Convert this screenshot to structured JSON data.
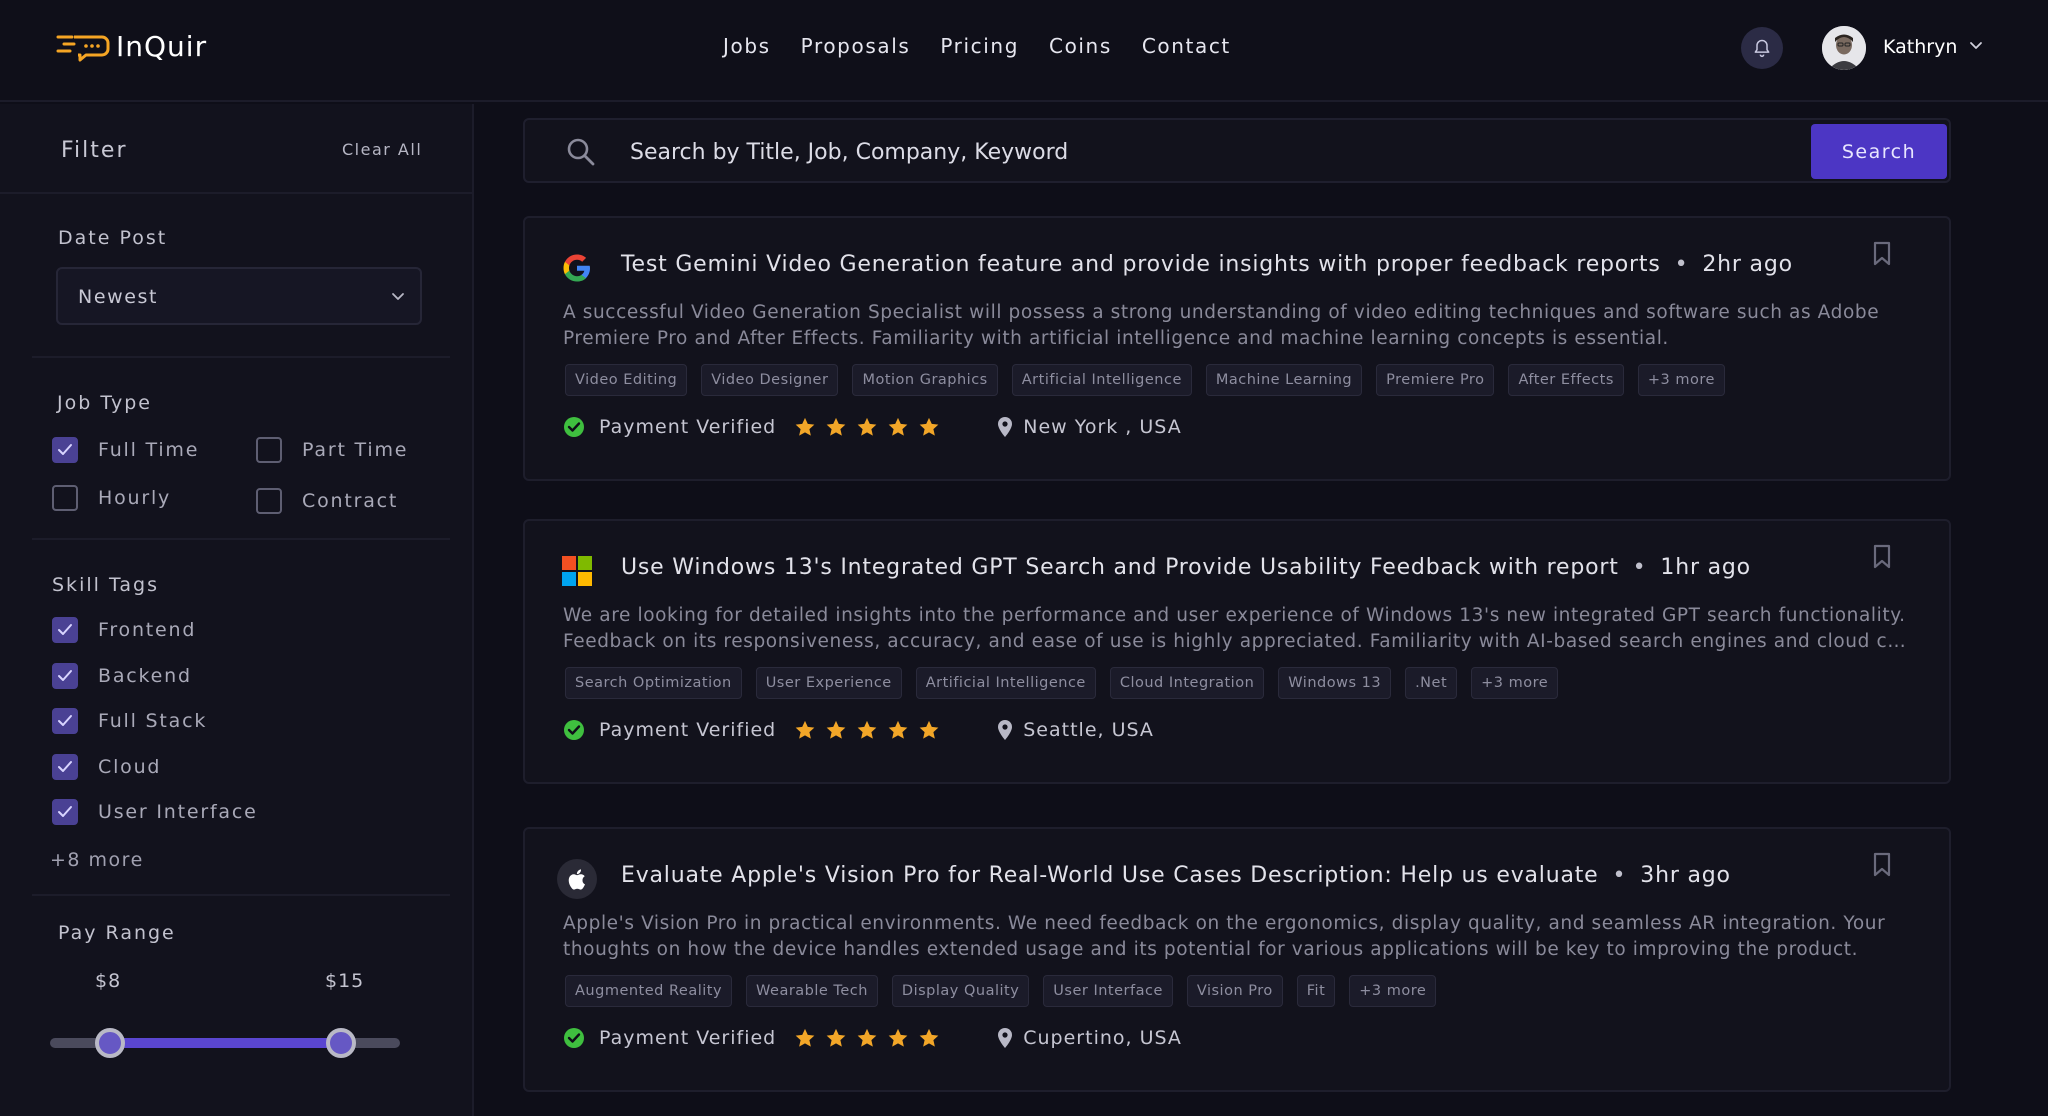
{
  "app": {
    "name": "InQuir",
    "accent": "#4c36c4",
    "logo_color": "#f5a524"
  },
  "nav": [
    "Jobs",
    "Proposals",
    "Pricing",
    "Coins",
    "Contact"
  ],
  "user": {
    "name": "Kathryn"
  },
  "filter": {
    "title": "Filter",
    "clear_all": "Clear All",
    "date_post": {
      "label": "Date Post",
      "value": "Newest"
    },
    "job_type": {
      "label": "Job Type",
      "options": [
        {
          "label": "Full Time",
          "checked": true
        },
        {
          "label": "Part Time",
          "checked": false
        },
        {
          "label": "Hourly",
          "checked": false
        },
        {
          "label": "Contract",
          "checked": false
        }
      ]
    },
    "skill_tags": {
      "label": "Skill Tags",
      "options": [
        {
          "label": "Frontend",
          "checked": true
        },
        {
          "label": "Backend",
          "checked": true
        },
        {
          "label": "Full Stack",
          "checked": true
        },
        {
          "label": "Cloud",
          "checked": true
        },
        {
          "label": "User Interface",
          "checked": true
        }
      ],
      "more": "+8 more"
    },
    "pay_range": {
      "label": "Pay Range",
      "min": "$8",
      "max": "$15",
      "min_fraction": 0.17,
      "max_fraction": 0.83
    }
  },
  "search": {
    "placeholder": "Search by Title, Job, Company, Keyword",
    "button": "Search"
  },
  "jobs": [
    {
      "logo": "google-logo",
      "title": "Test Gemini Video Generation feature and provide insights with proper feedback reports",
      "time": "2hr ago",
      "desc_line1": "A successful Video Generation Specialist will possess a strong understanding of video editing techniques and software such as Adobe",
      "desc_line2": "Premiere Pro and After Effects. Familiarity with artificial intelligence and machine learning concepts is essential.",
      "tags": [
        "Video Editing",
        "Video Designer",
        "Motion Graphics",
        "Artificial Intelligence",
        "Machine Learning",
        "Premiere Pro",
        "After Effects",
        "+3 more"
      ],
      "verified": "Payment Verified",
      "rating": 5,
      "location": "New York , USA"
    },
    {
      "logo": "microsoft-logo",
      "title": "Use Windows 13's Integrated GPT Search and Provide Usability Feedback with report",
      "time": "1hr ago",
      "desc_line1": "We are looking for detailed insights into the performance and user experience of Windows 13's new integrated GPT search functionality.",
      "desc_line2": "Feedback on its responsiveness, accuracy, and ease of use is highly appreciated. Familiarity with AI-based search engines and cloud comput...",
      "tags": [
        "Search Optimization",
        "User Experience",
        "Artificial Intelligence",
        "Cloud Integration",
        "Windows 13",
        ".Net",
        "+3 more"
      ],
      "verified": "Payment Verified",
      "rating": 5,
      "location": "Seattle, USA"
    },
    {
      "logo": "apple-logo",
      "title": "Evaluate Apple's Vision Pro for Real-World Use Cases Description: Help us evaluate",
      "time": "3hr ago",
      "desc_line1": "Apple's Vision Pro in practical environments. We need feedback on the ergonomics, display quality, and seamless AR integration. Your",
      "desc_line2": "thoughts on how the device handles extended usage and its potential for various applications will be key to improving the product.",
      "tags": [
        "Augmented Reality",
        "Wearable Tech",
        "Display Quality",
        "User Interface",
        "Vision Pro",
        "Fit",
        "+3 more"
      ],
      "verified": "Payment Verified",
      "rating": 5,
      "location": "Cupertino, USA"
    }
  ]
}
